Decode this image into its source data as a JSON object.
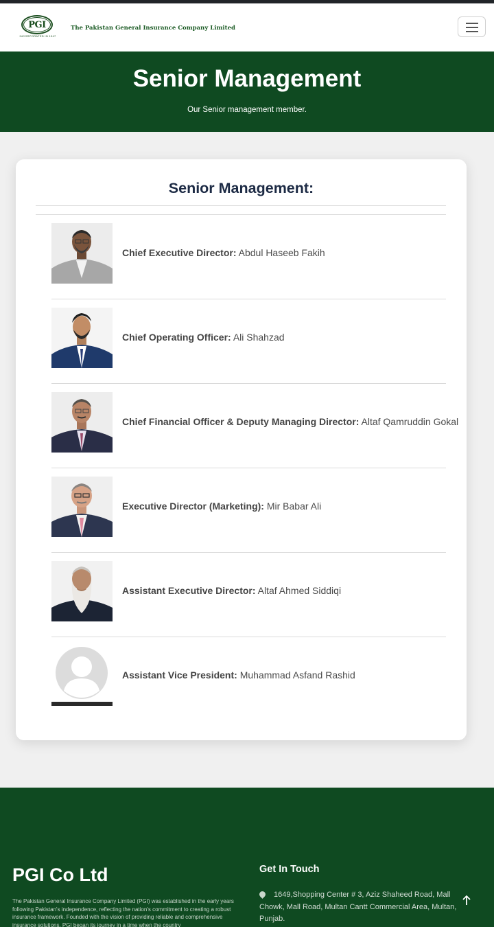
{
  "header": {
    "logo_text": "PGI",
    "logo_tagline": "INCORPORATED IN 1947",
    "company_name": "The Pakistan General Insurance Company Limited",
    "menu_icon": "hamburger-icon"
  },
  "hero": {
    "title": "Senior Management",
    "subtitle": "Our Senior management member."
  },
  "management": {
    "heading": "Senior Management:",
    "members": [
      {
        "role": "Chief Executive Director:",
        "name": "Abdul Haseeb Fakih"
      },
      {
        "role": "Chief Operating Officer:",
        "name": "Ali Shahzad"
      },
      {
        "role": "Chief Financial Officer & Deputy Managing Director:",
        "name": "Altaf Qamruddin Gokal"
      },
      {
        "role": "Executive Director (Marketing):",
        "name": "Mir Babar Ali"
      },
      {
        "role": "Assistant Executive Director:",
        "name": "Altaf Ahmed Siddiqi"
      },
      {
        "role": "Assistant Vice President:",
        "name": "Muhammad Asfand Rashid"
      }
    ]
  },
  "footer": {
    "title": "PGI Co Ltd",
    "about": "The Pakistan General Insurance Company Limited (PGI) was established in the early years following Pakistan's independence, reflecting the nation's commitment to creating a robust insurance framework. Founded with the vision of providing reliable and comprehensive insurance solutions, PGI began its journey in a time when the country",
    "contact_heading": "Get In Touch",
    "address": "1649,Shopping Center # 3, Aziz Shaheed Road, Mall Chowk, Mall Road, Multan Cantt Commercial Area, Multan, Punjab.",
    "back_to_top_icon": "arrow-up-icon"
  },
  "colors": {
    "brand_green": "#0f4a21",
    "heading_navy": "#1c2a44",
    "top_strip": "#212529"
  }
}
